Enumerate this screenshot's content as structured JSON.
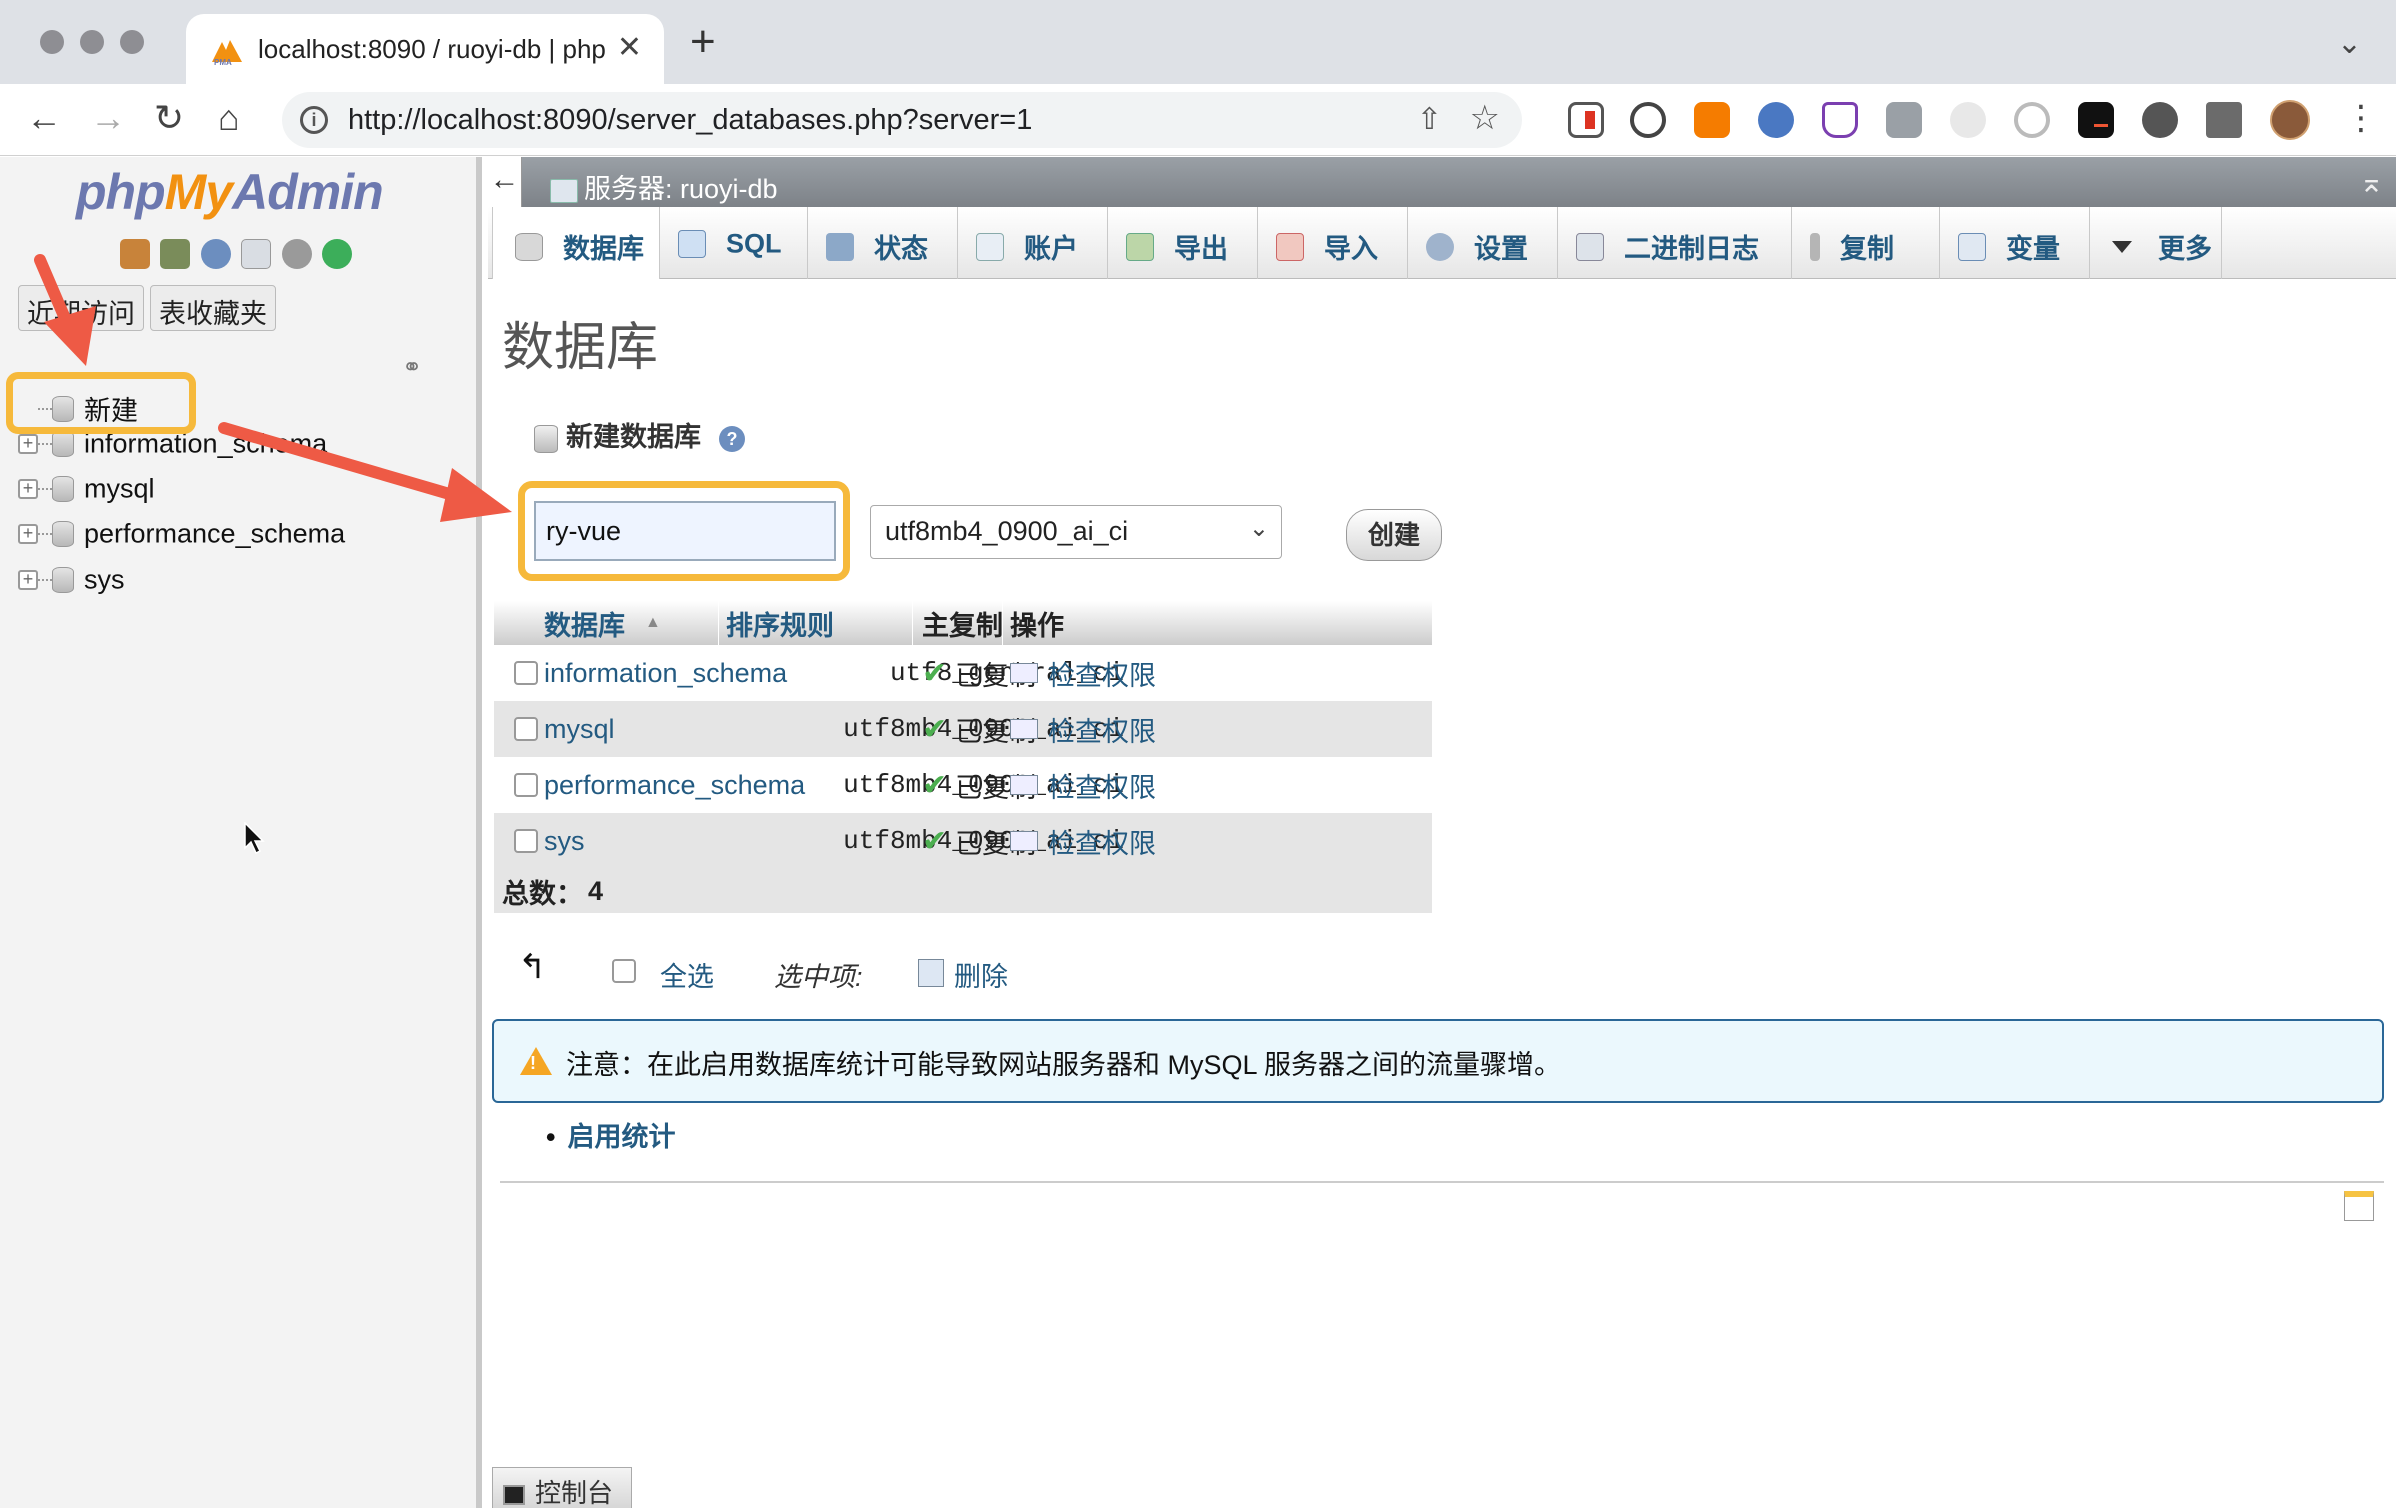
{
  "browser": {
    "tab_title": "localhost:8090 / ruoyi-db | php",
    "tab_close": "✕",
    "new_tab": "+",
    "tab_menu": "⌄",
    "url": "http://localhost:8090/server_databases.php?server=1",
    "nav": {
      "back": "←",
      "forward": "→",
      "reload": "↻",
      "home": "⌂"
    },
    "omnibox_info": "i",
    "share": "⇧",
    "star": "☆",
    "menu": "⋮",
    "extensions": [
      "extension-red-icon",
      "extension-sync-icon",
      "extension-chart-icon",
      "extension-blue-circle-icon",
      "extension-flask-icon",
      "extension-office-icon",
      "extension-gear-icon",
      "extension-ring-icon",
      "extension-terminal-icon",
      "extension-globe-icon",
      "puzzle-icon"
    ]
  },
  "sidebar": {
    "logo": {
      "php": "php",
      "my": "My",
      "admin": "Admin"
    },
    "icons": [
      "home-icon",
      "exit-icon",
      "help-icon",
      "docs-icon",
      "settings-icon",
      "reload-icon"
    ],
    "tabs": [
      "近期访问",
      "表收藏夹"
    ],
    "link_icon": "⚭",
    "tree": [
      {
        "label": "新建",
        "type": "new"
      },
      {
        "label": "information_schema",
        "type": "db"
      },
      {
        "label": "mysql",
        "type": "db"
      },
      {
        "label": "performance_schema",
        "type": "db"
      },
      {
        "label": "sys",
        "type": "db"
      }
    ]
  },
  "serverbar": {
    "back": "←",
    "label": "服务器: ruoyi-db",
    "collapse": "⌅"
  },
  "menu_tabs": [
    {
      "label": "数据库",
      "icon": "database-icon",
      "active": true
    },
    {
      "label": "SQL",
      "icon": "sql-icon"
    },
    {
      "label": "状态",
      "icon": "status-icon"
    },
    {
      "label": "账户",
      "icon": "accounts-icon"
    },
    {
      "label": "导出",
      "icon": "export-icon"
    },
    {
      "label": "导入",
      "icon": "import-icon"
    },
    {
      "label": "设置",
      "icon": "wrench-icon"
    },
    {
      "label": "二进制日志",
      "icon": "binlog-icon"
    },
    {
      "label": "复制",
      "icon": "replication-icon"
    },
    {
      "label": "变量",
      "icon": "variables-icon"
    },
    {
      "label": "更多",
      "icon": "triangle-down-icon"
    }
  ],
  "main": {
    "heading": "数据库",
    "create_label": "新建数据库",
    "help": "?",
    "dbname_value": "ry-vue",
    "collation_value": "utf8mb4_0900_ai_ci",
    "collation_caret": "⌄",
    "create_button": "创建"
  },
  "table": {
    "headers": {
      "database": "数据库",
      "collation": "排序规则",
      "replication": "主复制",
      "actions": "操作",
      "sort": "▲"
    },
    "rows": [
      {
        "name": "information_schema",
        "collation": "utf8_general_ci",
        "replication": "已复制",
        "action": "检查权限"
      },
      {
        "name": "mysql",
        "collation": "utf8mb4_0900_ai_ci",
        "replication": "已复制",
        "action": "检查权限"
      },
      {
        "name": "performance_schema",
        "collation": "utf8mb4_0900_ai_ci",
        "replication": "已复制",
        "action": "检查权限"
      },
      {
        "name": "sys",
        "collation": "utf8mb4_0900_ai_ci",
        "replication": "已复制",
        "action": "检查权限"
      }
    ],
    "check_glyph": "✔",
    "total_label": "总数：",
    "total_value": "4"
  },
  "bulk": {
    "arrow": "↰",
    "select_all": "全选",
    "with_selected": "选中项:",
    "delete": "删除"
  },
  "notice": {
    "icon": "warning-icon",
    "excl": "!",
    "text": "注意：在此启用数据库统计可能导致网站服务器和 MySQL 服务器之间的流量骤增。"
  },
  "enable_stats": {
    "bullet": "•",
    "label": "启用统计"
  },
  "console": {
    "label": "控制台"
  },
  "colors": {
    "link": "#235a81",
    "highlight": "#f6b93b",
    "arrow": "#ee5a45",
    "notice_bg": "#ebf8fd"
  }
}
